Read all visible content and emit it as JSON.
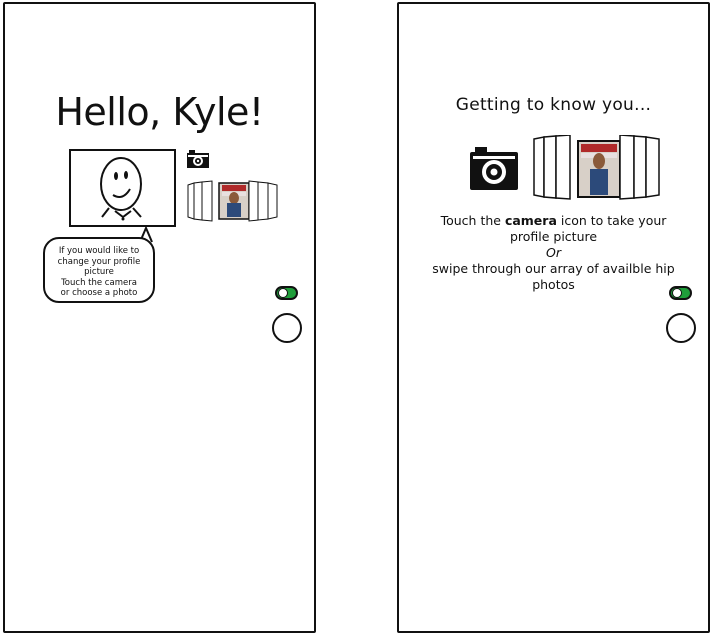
{
  "screen1": {
    "greeting": "Hello, Kyle!",
    "speech_lines": [
      "If you would like to",
      "change your profile",
      "picture",
      "Touch the camera",
      "or choose a photo"
    ],
    "toggle_on": true,
    "avatar_icon": "smiley-face-sketch",
    "camera_icon": "camera-icon"
  },
  "screen2": {
    "title": "Getting to know you...",
    "instruction_prefix": "Touch the ",
    "instruction_bold": "camera",
    "instruction_suffix": " icon to take your profile picture",
    "or_text": "Or",
    "swipe_text": "swipe through our array of availble hip photos",
    "toggle_on": true,
    "camera_icon": "camera-icon"
  },
  "colors": {
    "toggle_green": "#1f9e3a",
    "outline": "#111111",
    "photo_red": "#b02a2a",
    "photo_blue": "#2c4a7a"
  }
}
